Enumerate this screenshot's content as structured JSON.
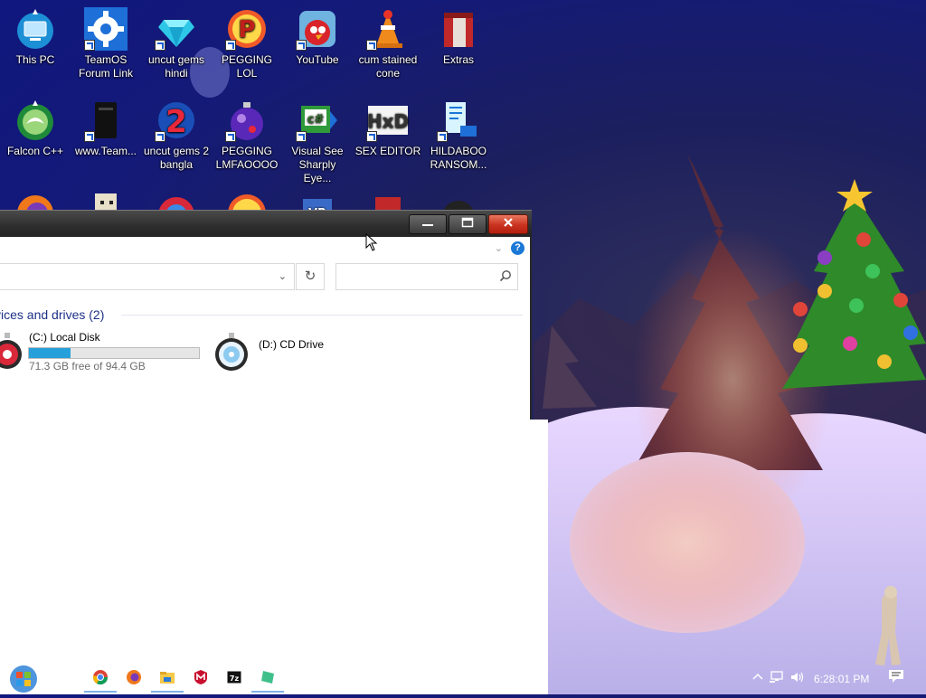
{
  "desktop": {
    "icons": [
      {
        "label": "This PC",
        "icon": "this-pc-icon"
      },
      {
        "label": "TeamOS Forum Link",
        "icon": "gear-icon"
      },
      {
        "label": "uncut gems hindi",
        "icon": "diamond-icon"
      },
      {
        "label": "PEGGING LOL",
        "icon": "p-logo-icon"
      },
      {
        "label": "YouTube",
        "icon": "angry-bird-icon"
      },
      {
        "label": "cum stained cone",
        "icon": "traffic-cone-icon"
      },
      {
        "label": "Extras",
        "icon": "extras-box-icon"
      },
      {
        "label": "Falcon C++",
        "icon": "falcon-icon"
      },
      {
        "label": "www.Team...",
        "icon": "black-device-icon"
      },
      {
        "label": "uncut gems 2 bangla",
        "icon": "number-two-icon"
      },
      {
        "label": "PEGGING LMFAOOOO",
        "icon": "christmas-ball-icon"
      },
      {
        "label": "Visual See Sharply Eye...",
        "icon": "csharp-icon"
      },
      {
        "label": "SEX EDITOR",
        "icon": "hxd-icon"
      },
      {
        "label": "HILDABOO RANSOM...",
        "icon": "script-icon"
      }
    ]
  },
  "explorer": {
    "title_buttons": {
      "minimize": "minimize-icon",
      "maximize": "maximize-icon",
      "close": "close-icon"
    },
    "help": "?",
    "group_header": "vices and drives (2)",
    "drives": [
      {
        "name": "(C:) Local Disk",
        "free_text": "71.3 GB free of 94.4 GB",
        "used_fraction": 0.245
      },
      {
        "name": "(D:) CD Drive"
      }
    ]
  },
  "taskbar": {
    "apps": [
      "chrome-icon",
      "firefox-icon",
      "file-explorer-icon",
      "mcafee-icon",
      "7zip-icon",
      "notepad-icon"
    ],
    "clock": "6:28:01 PM"
  },
  "colors": {
    "accent": "#26a0da",
    "close": "#c8321f",
    "group_header": "#1e3287"
  }
}
